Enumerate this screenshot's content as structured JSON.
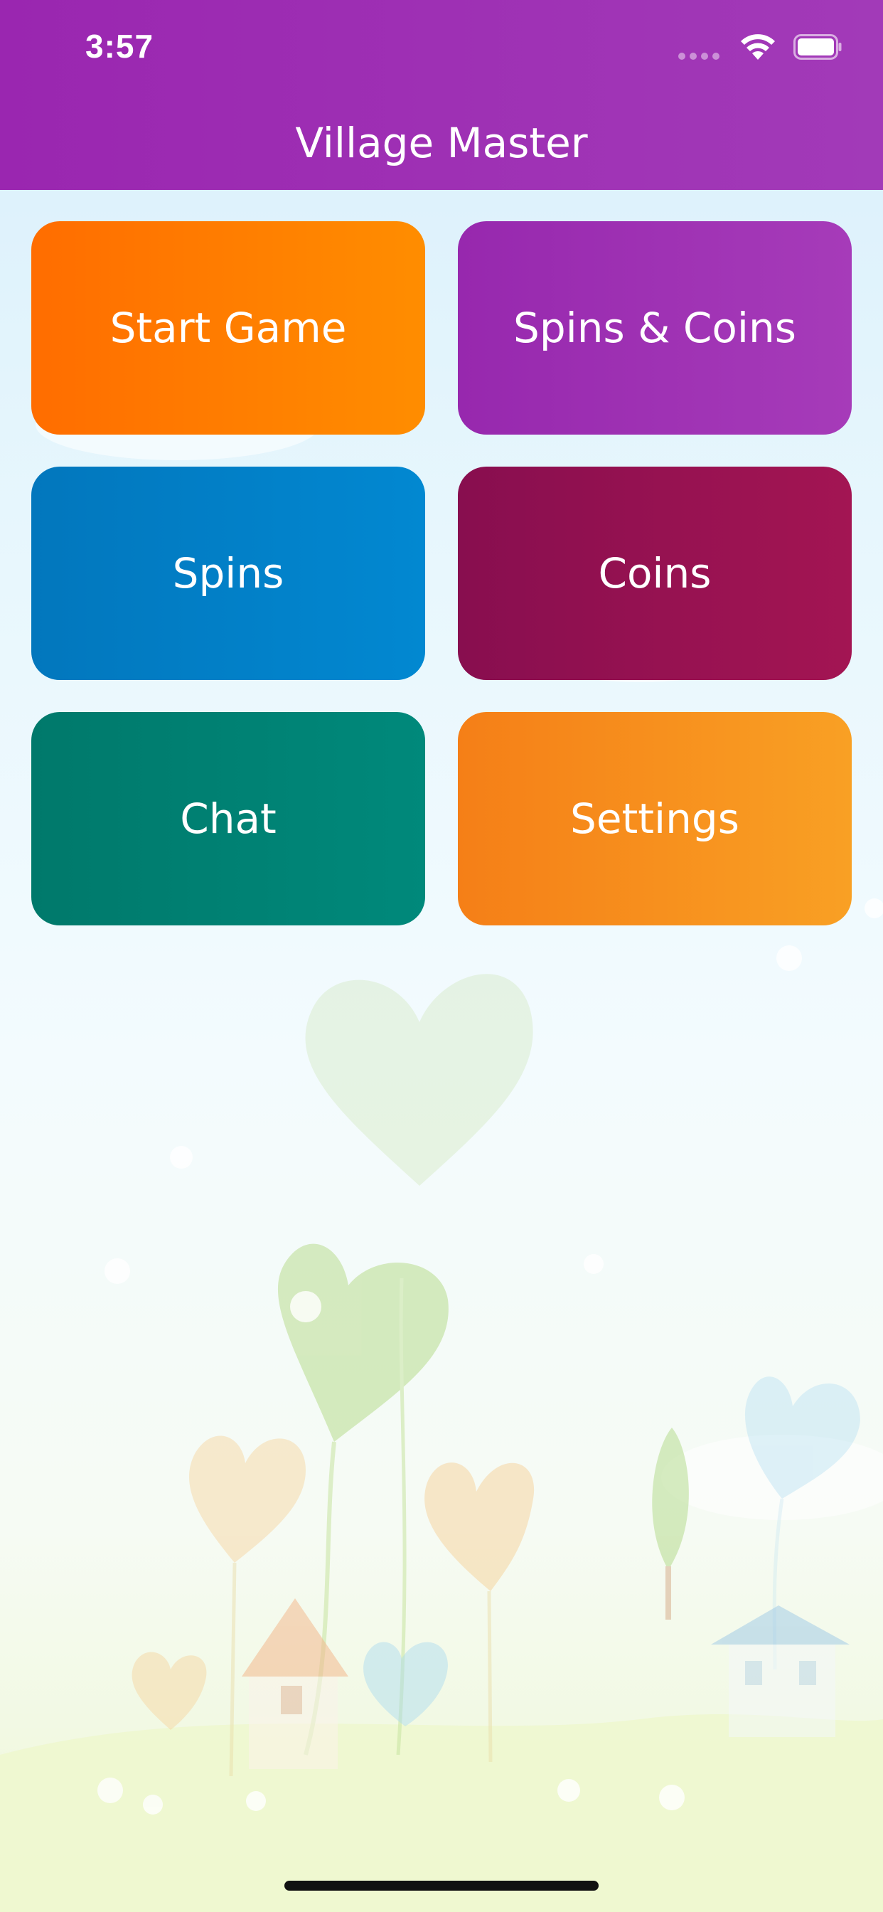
{
  "status_bar": {
    "time": "3:57",
    "icons": [
      "signal-icon",
      "wifi-icon",
      "battery-icon"
    ]
  },
  "header": {
    "title": "Village Master",
    "color": "#9c27b0"
  },
  "menu": {
    "start_game": {
      "label": "Start Game",
      "color": "#ff7a00"
    },
    "spins_coins": {
      "label": "Spins & Coins",
      "color": "#9c27b0"
    },
    "spins": {
      "label": "Spins",
      "color": "#0288d1"
    },
    "coins": {
      "label": "Coins",
      "color": "#950f50"
    },
    "chat": {
      "label": "Chat",
      "color": "#00796b"
    },
    "settings": {
      "label": "Settings",
      "color": "#f7911e"
    }
  },
  "background": {
    "decorations": [
      "heart-icon",
      "house-icon",
      "tree-icon",
      "sparkle-icon"
    ]
  }
}
